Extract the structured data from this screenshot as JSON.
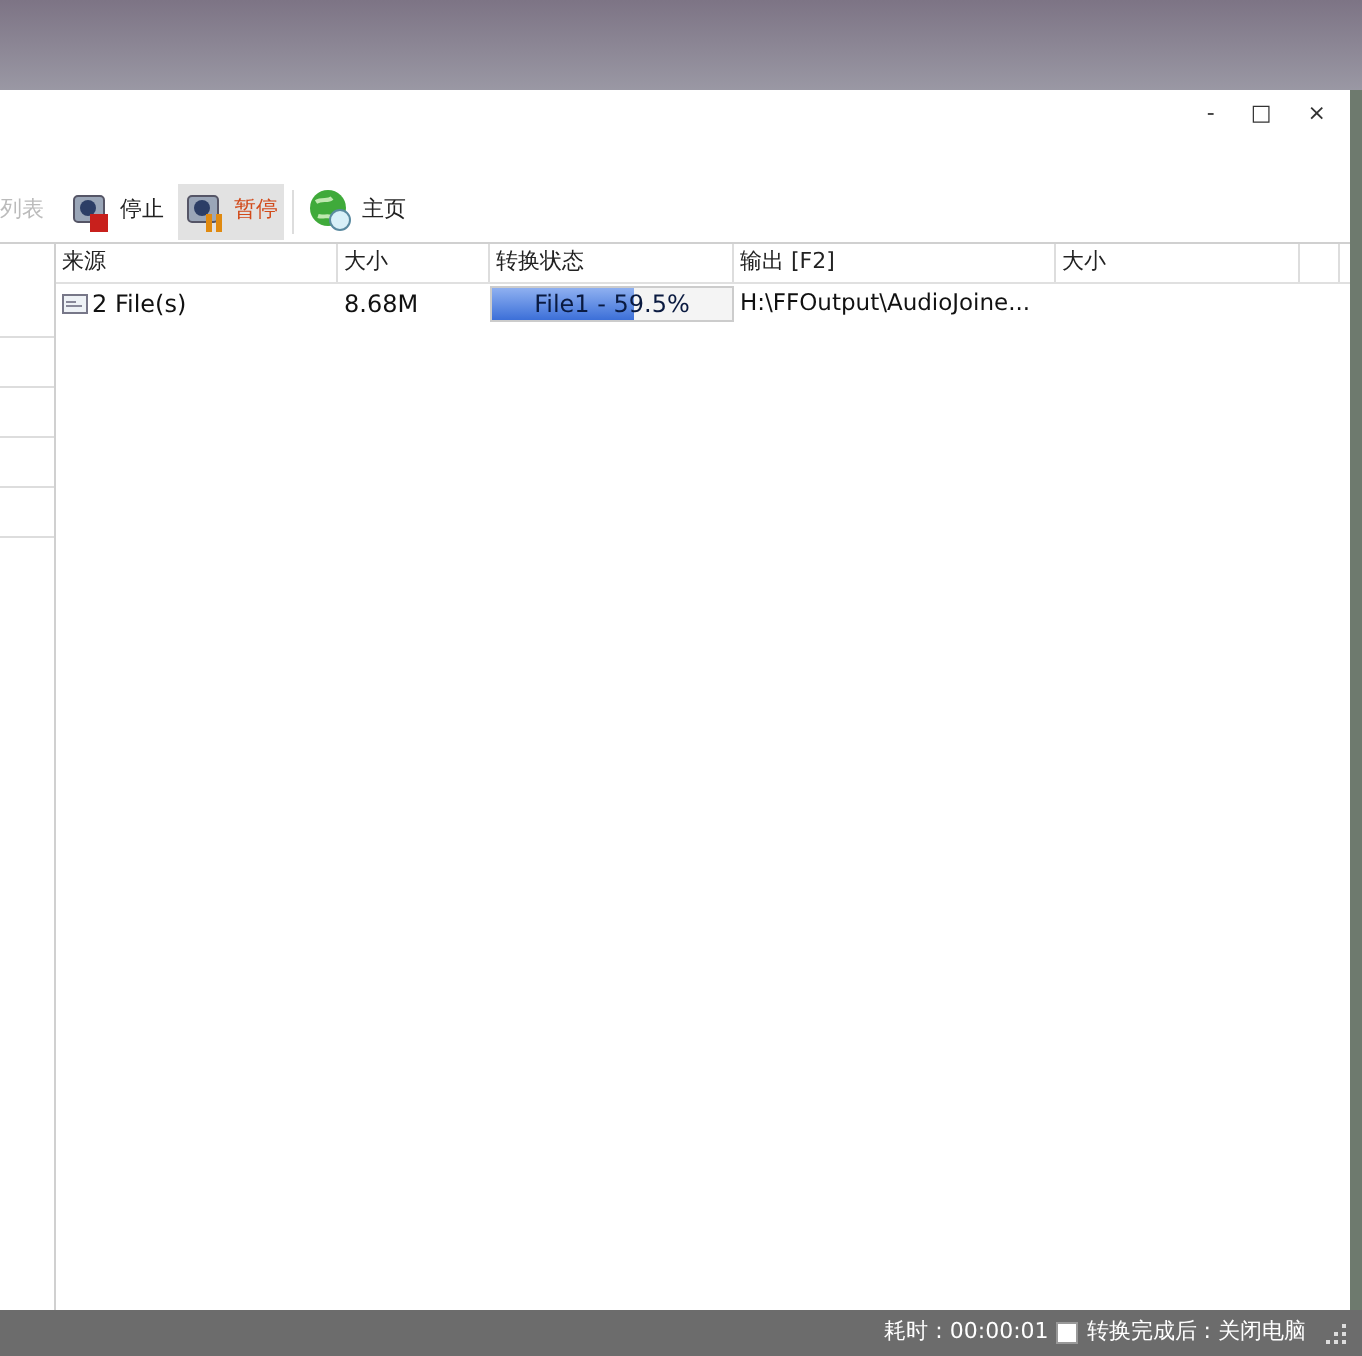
{
  "window_controls": [
    "-",
    "□",
    "×"
  ],
  "left_panel": {
    "tab_label": "列表"
  },
  "toolbar": [
    {
      "kind": "stop",
      "label": "停止",
      "active": false
    },
    {
      "kind": "pause",
      "label": "暂停",
      "active": true
    },
    {
      "kind": "home",
      "label": "主页",
      "active": false
    }
  ],
  "table": {
    "columns": [
      "来源",
      "大小",
      "转换状态",
      "输出 [F2]",
      "大小"
    ],
    "rows": [
      {
        "source": "2 File(s)",
        "size": "8.68M",
        "status": "File1 - 59.5%",
        "level": 0.595,
        "output": "H:\\FFOutput\\AudioJoine..."
      }
    ]
  },
  "status_bar": {
    "elapsed": "耗时 : 00:00:01",
    "shutdown_checkbox": {
      "checked": false,
      "label": "转换完成后 : 关闭电脑"
    }
  }
}
